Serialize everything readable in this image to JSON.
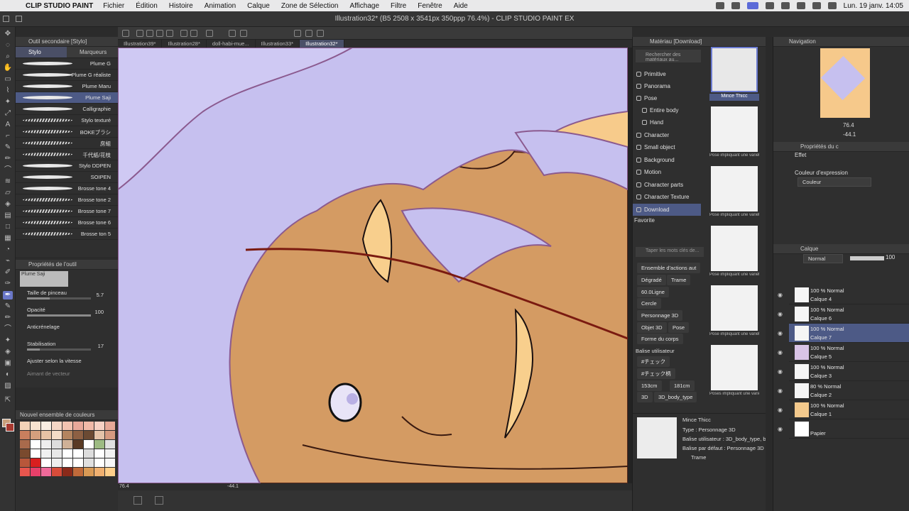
{
  "menubar": {
    "app": "CLIP STUDIO PAINT",
    "items": [
      "Fichier",
      "Édition",
      "Histoire",
      "Animation",
      "Calque",
      "Zone de Sélection",
      "Affichage",
      "Filtre",
      "Fenêtre",
      "Aide"
    ],
    "datetime": "Lun. 19 janv.  14:05"
  },
  "window": {
    "title": "Illustration32* (B5 2508 x 3541px 350ppp 76.4%) - CLIP STUDIO PAINT EX"
  },
  "document_tabs": [
    "Illustration39*",
    "Illustration28*",
    "doll-habi-mue...",
    "Illustration33*",
    "Illustration32*"
  ],
  "subtool": {
    "header": "Outil secondaire [Stylo]",
    "tabs": [
      "Stylo",
      "Marqueurs"
    ],
    "brushes": [
      "Plume G",
      "Plume G réaliste",
      "Plume Maru",
      "Plume Saji",
      "Calligraphie",
      "Stylo texturé",
      "BOKEブラシ",
      "房組",
      "千代紙/花枝",
      "Stylo DDPEN",
      "SOIPEN",
      "Brosse tone 4",
      "Brosse tone 2",
      "Brosse tone 7",
      "Brosse tone 6",
      "Brosse ton 5"
    ],
    "selected_index": 3
  },
  "tool_props": {
    "header": "Propriétés de l'outil",
    "preview_name": "Plume Saji",
    "brush_size_label": "Taille de pinceau",
    "brush_size_value": "5.7",
    "brush_size_fill": 0.35,
    "opacity_label": "Opacité",
    "opacity_value": "100",
    "opacity_fill": 1.0,
    "antialias_label": "Anticrénelage",
    "stabilization_label": "Stabilisation",
    "stabilization_value": "17",
    "stabilization_fill": 0.2,
    "speed_label": "Ajuster selon la vitesse",
    "vector_label": "Aimant de vecteur"
  },
  "palette": {
    "header": "Nouvel ensemble de couleurs",
    "colors": [
      "#f4d3b8",
      "#f7e3d0",
      "#f9ede2",
      "#f5d6c5",
      "#f2c2b0",
      "#e8a89a",
      "#f0b9a8",
      "#f7d1c4",
      "#e7a897",
      "#c97f5e",
      "#d59f7e",
      "#e7c3a5",
      "#f4dcc7",
      "#b3845f",
      "#8d6043",
      "#6b4a33",
      "#e4c3a9",
      "#d69a80",
      "#a96a4c",
      "#ffffff",
      "#eeeeee",
      "#dddddd",
      "#cfb197",
      "#5a3a24",
      "#ffffff",
      "#9dbb83",
      "#e0e0e0",
      "#7a4a2e",
      "#ffffff",
      "#f0f0f0",
      "#e8e8e8",
      "#ffffff",
      "#ffffff",
      "#dddddd",
      "#ffffff",
      "#f2f2f2",
      "#b8573a",
      "#d91f1f",
      "#ffffff",
      "#eeeeee",
      "#ffffff",
      "#ffffff",
      "#e0e0e0",
      "#ffffff",
      "#f7f7f7",
      "#e8564e",
      "#e8406a",
      "#f06a9a",
      "#d84c3a",
      "#8a2a1a",
      "#c06a3a",
      "#d99a55",
      "#f0b070",
      "#ffcf8a"
    ]
  },
  "status": {
    "zoom": "76.4",
    "angle": "-44.1"
  },
  "material": {
    "header": "Matériau [Download]",
    "search_placeholder": "Rechercher des matériaux au...",
    "categories": [
      "Primitive",
      "Panorama",
      "Pose",
      "Entire body",
      "Hand",
      "Character",
      "Small object",
      "Background",
      "Motion",
      "Character parts",
      "Character Texture",
      "Download"
    ],
    "favorite": "Favorite",
    "tag_search_placeholder": "Taper les mots clés de...",
    "tags": [
      "Ensemble d'actions aut",
      "Dégradé",
      "Trame",
      "60.0Ligne",
      "Cercle",
      "Personnage 3D",
      "Objet 3D",
      "Pose",
      "Forme du corps"
    ],
    "user_tags_label": "Balise utilisateur",
    "user_tags": [
      "#チェック",
      "#チェック柄",
      "153cm",
      "181cm",
      "3D",
      "3D_body_type"
    ],
    "thumbs": [
      "Mince Thicc",
      "Pose impliquant une variété...",
      "Pose impliquant une variété...",
      "Pose impliquant une variété...",
      "Pose impliquant une variété...",
      "Poses impliquant une variété..."
    ],
    "detail": {
      "name": "Mince Thicc",
      "type": "Type : Personnage 3D",
      "user_tags": "Balise utilisateur : 3D_body_type, big_body...",
      "default_tag": "Balise par défaut : Personnage 3D",
      "check": "Trame"
    }
  },
  "navigation": {
    "header": "Navigation",
    "zoom": "76.4",
    "angle": "-44.1"
  },
  "layer_props": {
    "header": "Propriétés du c",
    "effect": "Effet",
    "expression_label": "Couleur d'expression",
    "expression_value": "Couleur"
  },
  "layers": {
    "header": "Calque",
    "blend_mode": "Normal",
    "opacity": "100",
    "items": [
      {
        "opacity": "100 % Normal",
        "name": "Calque 4",
        "thumb": "#f5f5f5"
      },
      {
        "opacity": "100 % Normal",
        "name": "Calque 6",
        "thumb": "#f5f5f5"
      },
      {
        "opacity": "100 % Normal",
        "name": "Calque 7",
        "thumb": "#f5f5f5"
      },
      {
        "opacity": "100 % Normal",
        "name": "Calque 5",
        "thumb": "#d9c3e6"
      },
      {
        "opacity": "100 % Normal",
        "name": "Calque 3",
        "thumb": "#f5f5f5"
      },
      {
        "opacity": "80 % Normal",
        "name": "Calque 2",
        "thumb": "#f5f5f5"
      },
      {
        "opacity": "100 % Normal",
        "name": "Calque 1",
        "thumb": "#f3c98c"
      },
      {
        "opacity": "",
        "name": "Papier",
        "thumb": "#ffffff"
      }
    ],
    "selected_index": 2
  },
  "colors": {
    "hair": "#c9c3f0",
    "skin": "#d39a63",
    "light_skin": "#f8cf8d",
    "line": "#8b5a8f",
    "accent": "#6a77c8"
  }
}
